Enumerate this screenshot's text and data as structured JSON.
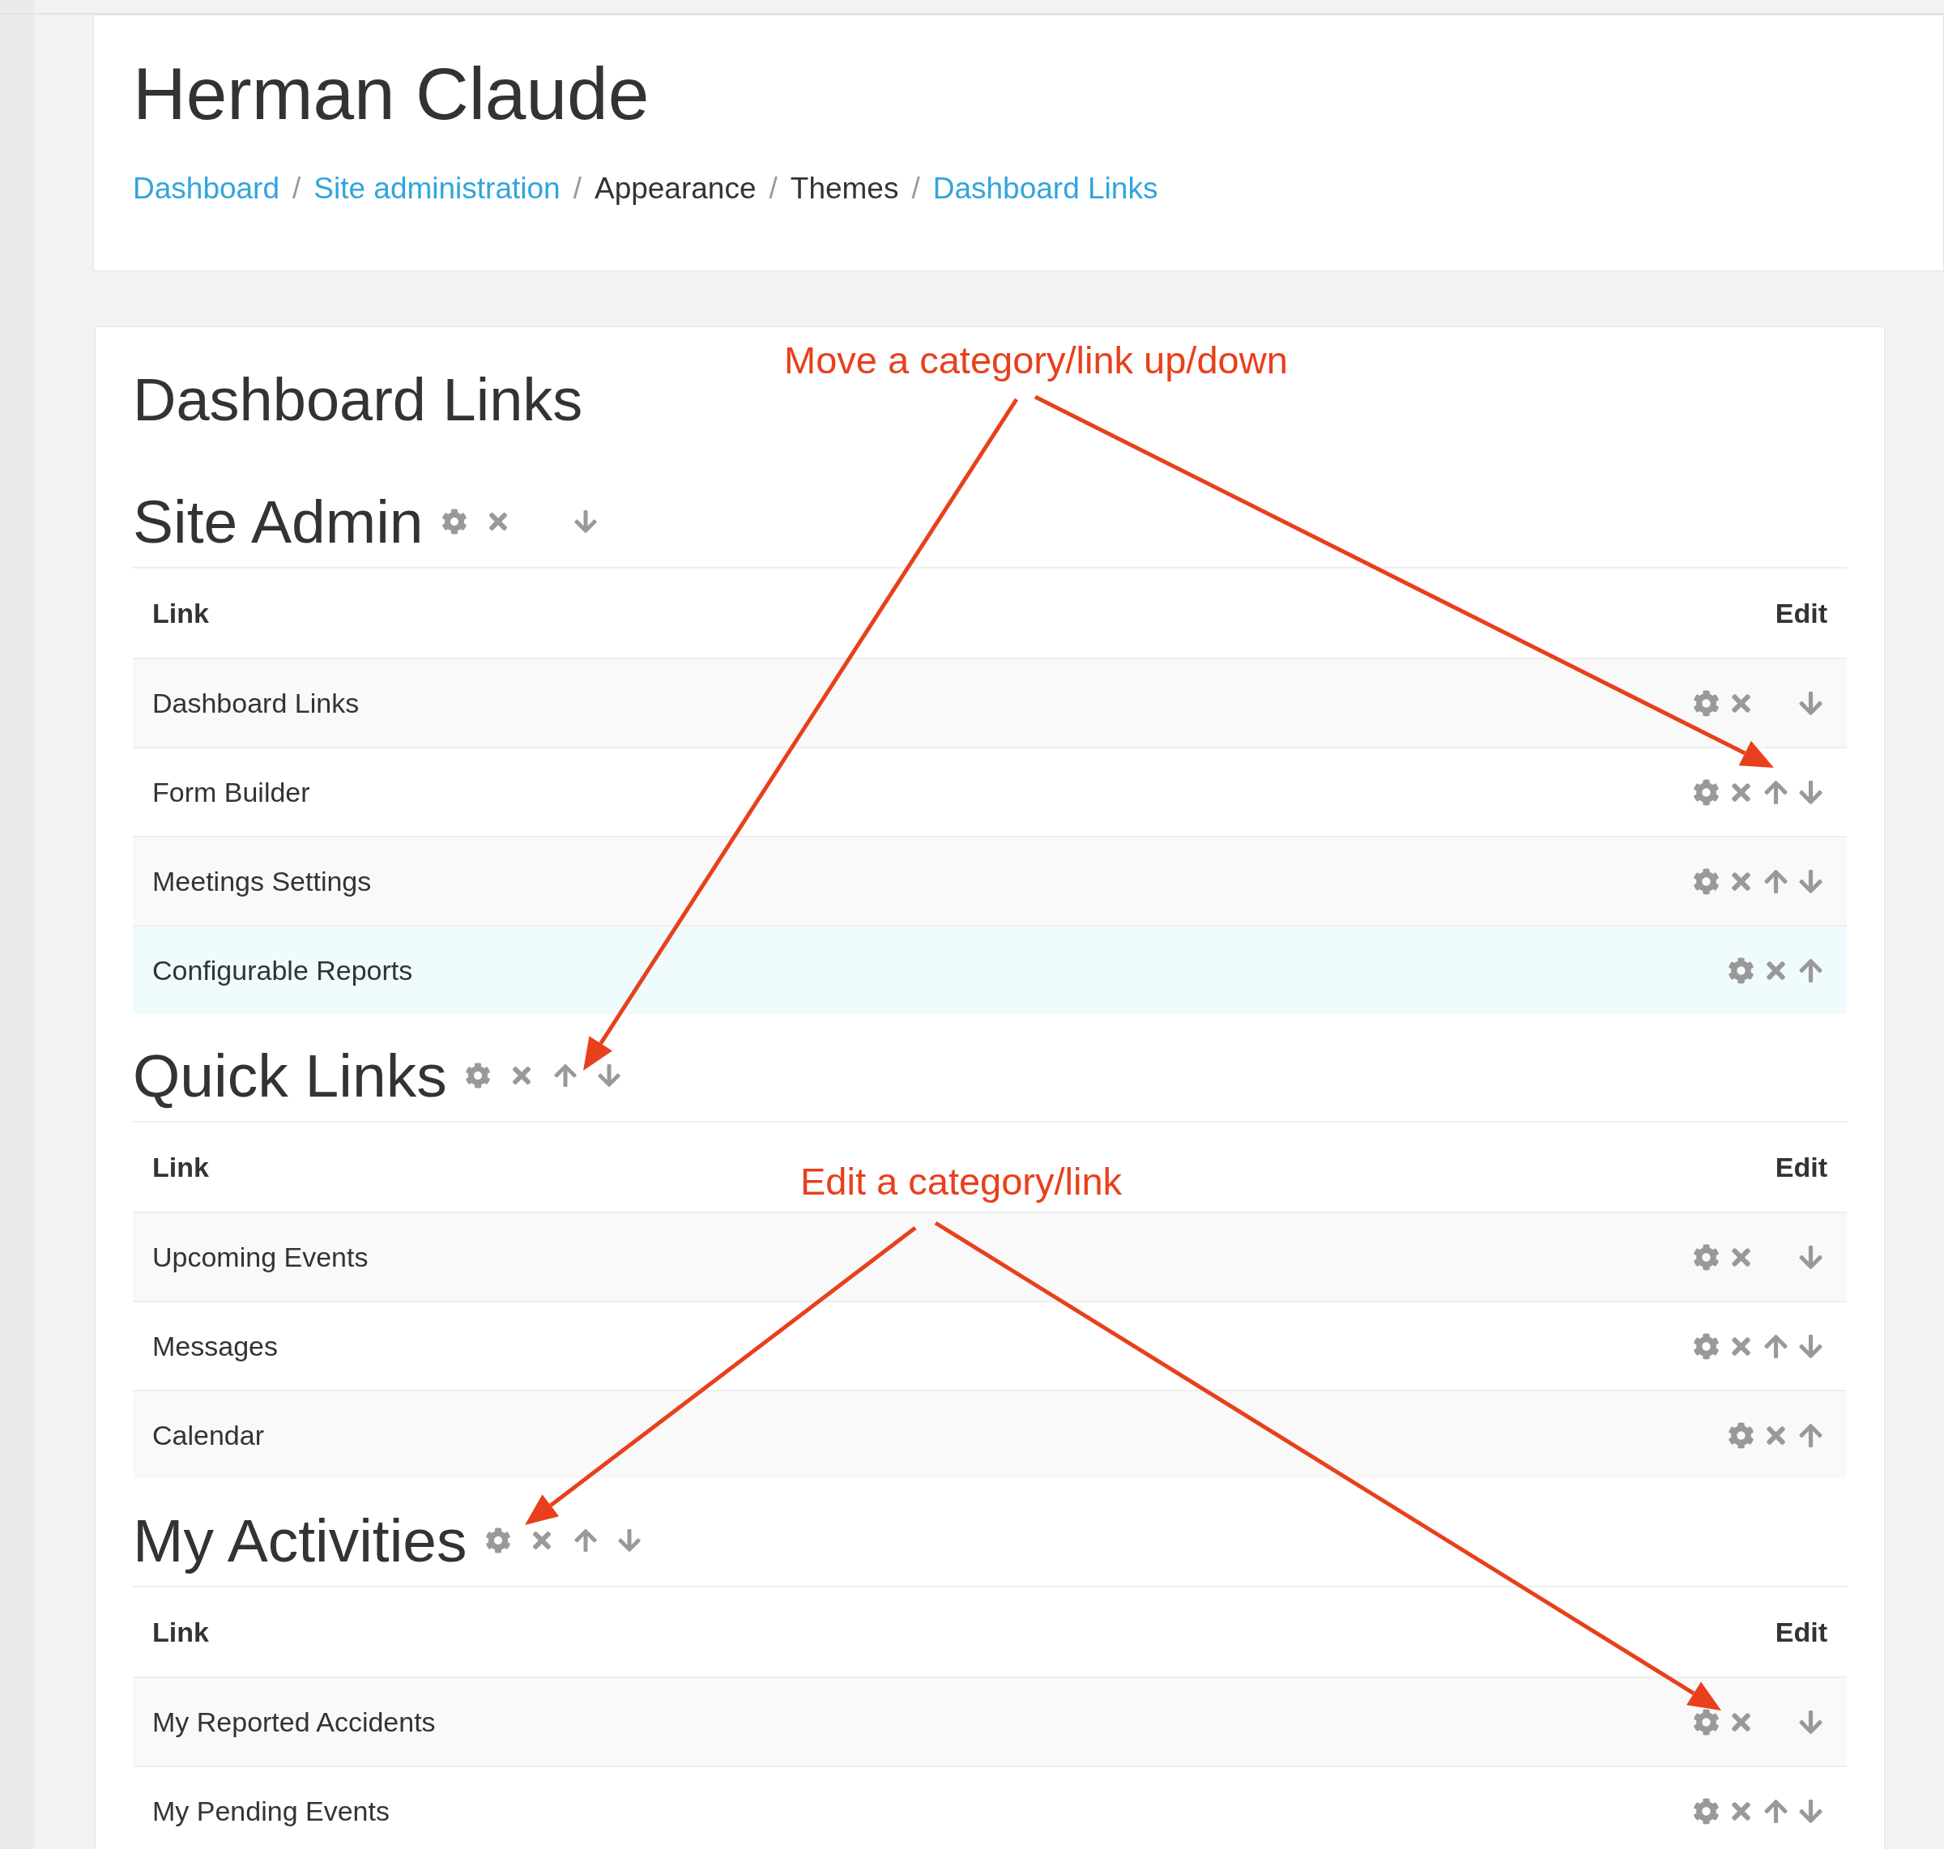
{
  "header": {
    "title": "Herman Claude",
    "breadcrumb": [
      {
        "label": "Dashboard",
        "link": true
      },
      {
        "label": "Site administration",
        "link": true
      },
      {
        "label": "Appearance",
        "link": false
      },
      {
        "label": "Themes",
        "link": false
      },
      {
        "label": "Dashboard Links",
        "link": true
      }
    ],
    "separator": "/"
  },
  "page_title": "Dashboard Links",
  "categories": [
    {
      "name": "Site Admin",
      "can_move_up": false,
      "can_move_down": true,
      "columns": [
        "Link",
        "Edit"
      ],
      "links": [
        {
          "name": "Dashboard Links",
          "can_move_up": false,
          "can_move_down": true,
          "hovered": false
        },
        {
          "name": "Form Builder",
          "can_move_up": true,
          "can_move_down": true,
          "hovered": false
        },
        {
          "name": "Meetings Settings",
          "can_move_up": true,
          "can_move_down": true,
          "hovered": false
        },
        {
          "name": "Configurable Reports",
          "can_move_up": true,
          "can_move_down": false,
          "hovered": true
        }
      ]
    },
    {
      "name": "Quick Links",
      "can_move_up": true,
      "can_move_down": true,
      "columns": [
        "Link",
        "Edit"
      ],
      "links": [
        {
          "name": "Upcoming Events",
          "can_move_up": false,
          "can_move_down": true,
          "hovered": false
        },
        {
          "name": "Messages",
          "can_move_up": true,
          "can_move_down": true,
          "hovered": false
        },
        {
          "name": "Calendar",
          "can_move_up": true,
          "can_move_down": false,
          "hovered": false
        }
      ]
    },
    {
      "name": "My Activities",
      "can_move_up": true,
      "can_move_down": true,
      "columns": [
        "Link",
        "Edit"
      ],
      "links": [
        {
          "name": "My Reported Accidents",
          "can_move_up": false,
          "can_move_down": true,
          "hovered": false
        },
        {
          "name": "My Pending Events",
          "can_move_up": true,
          "can_move_down": true,
          "hovered": false
        }
      ]
    }
  ],
  "annotations": [
    {
      "text": "Move a category/link up/down"
    },
    {
      "text": "Edit a category/link"
    }
  ]
}
